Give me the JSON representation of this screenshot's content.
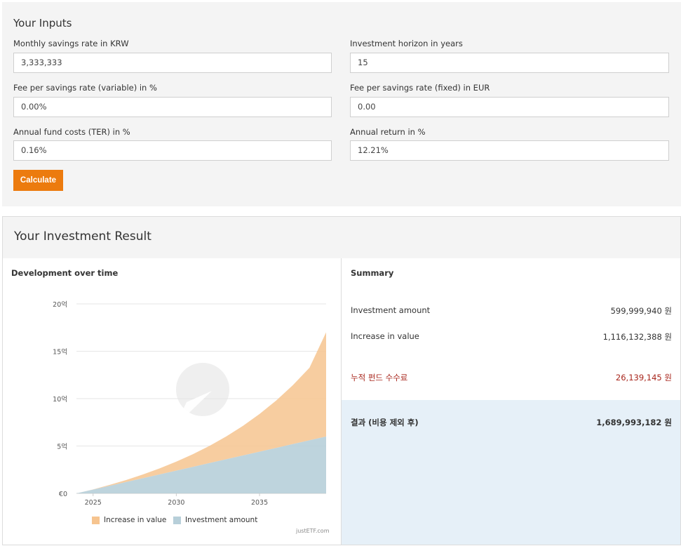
{
  "inputs": {
    "title": "Your Inputs",
    "monthly_savings": {
      "label": "Monthly savings rate in KRW",
      "value": "3,333,333"
    },
    "horizon": {
      "label": "Investment horizon in years",
      "value": "15"
    },
    "fee_variable": {
      "label": "Fee per savings rate (variable) in %",
      "value": "0.00%"
    },
    "fee_fixed": {
      "label": "Fee per savings rate (fixed) in EUR",
      "value": "0.00"
    },
    "ter": {
      "label": "Annual fund costs (TER) in %",
      "value": "0.16%"
    },
    "annual_return": {
      "label": "Annual return in %",
      "value": "12.21%"
    },
    "calculate_label": "Calculate"
  },
  "result": {
    "title": "Your Investment Result",
    "development_title": "Development over time",
    "credit": "justETF.com",
    "summary": {
      "title": "Summary",
      "investment_amount_label": "Investment amount",
      "investment_amount_value": "599,999,940 원",
      "increase_label": "Increase in value",
      "increase_value": "1,116,132,388 원",
      "fees_label": "누적 펀드 수수료",
      "fees_value": "26,139,145 원",
      "total_label": "결과 (비용 제외 후)",
      "total_value": "1,689,993,182 원"
    }
  },
  "colors": {
    "accent": "#ec7b0e",
    "increase": "#f6c48f",
    "investment": "#b7cfd9",
    "fee_text": "#a8261c",
    "total_bg": "#e6f0f8"
  },
  "chart_data": {
    "type": "area",
    "title": "Development over time",
    "x": [
      2024,
      2025,
      2026,
      2027,
      2028,
      2029,
      2030,
      2031,
      2032,
      2033,
      2034,
      2035,
      2036,
      2037,
      2038,
      2039
    ],
    "x_ticks": [
      "2025",
      "2030",
      "2035"
    ],
    "y_ticks": [
      "€0",
      "5억",
      "10억",
      "15억",
      "20억"
    ],
    "y_tick_values": [
      0,
      5,
      10,
      15,
      20
    ],
    "ylim": [
      0,
      20
    ],
    "stacked": true,
    "series": [
      {
        "name": "Investment amount",
        "color": "#b7cfd9",
        "values": [
          0,
          0.4,
          0.8,
          1.2,
          1.6,
          2.0,
          2.4,
          2.8,
          3.2,
          3.6,
          4.0,
          4.4,
          4.8,
          5.2,
          5.6,
          6.0
        ]
      },
      {
        "name": "Increase in value",
        "color": "#f6c48f",
        "values": [
          0,
          0.02,
          0.1,
          0.22,
          0.4,
          0.64,
          0.95,
          1.34,
          1.82,
          2.41,
          3.12,
          3.98,
          5.0,
          6.22,
          7.66,
          11.0
        ]
      }
    ],
    "legend": [
      "Increase in value",
      "Investment amount"
    ],
    "legend_position": "bottom",
    "grid": true
  }
}
